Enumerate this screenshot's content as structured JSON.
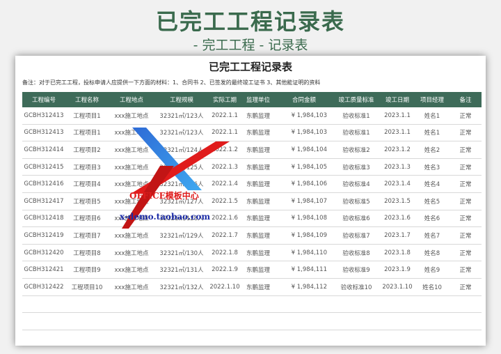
{
  "hero": {
    "title": "已完工工程记录表",
    "subtitle": "- 完工工程  - 记录表"
  },
  "sheet": {
    "title": "已完工工程记录表",
    "note": "备注：对于已完工工程，投标申请人应提供一下方面的材料：1、合同书 2、已签发的最终竣工证书 3、其他能证明的资料"
  },
  "table": {
    "headers": [
      "工程编号",
      "工程名称",
      "工程地点",
      "工程规模",
      "实际工期",
      "监理单位",
      "合同金额",
      "竣工质量标准",
      "竣工日期",
      "项目经理",
      "备注"
    ],
    "rows": [
      [
        "GCBH312413",
        "工程项目1",
        "xxx施工地点",
        "32321㎡/123人",
        "2022.1.1",
        "东鹏监理",
        "¥ 1,984,103",
        "验收标准1",
        "2023.1.1",
        "姓名1",
        "正常"
      ],
      [
        "GCBH312413",
        "工程项目1",
        "xxx施工地点",
        "32321㎡/123人",
        "2022.1.1",
        "东鹏监理",
        "¥ 1,984,103",
        "验收标准1",
        "2023.1.1",
        "姓名1",
        "正常"
      ],
      [
        "GCBH312414",
        "工程项目2",
        "xxx施工地点",
        "32321㎡/124人",
        "2022.1.2",
        "东鹏监理",
        "¥ 1,984,104",
        "验收标准2",
        "2023.1.2",
        "姓名2",
        "正常"
      ],
      [
        "GCBH312415",
        "工程项目3",
        "xxx施工地点",
        "32321㎡/125人",
        "2022.1.3",
        "东鹏监理",
        "¥ 1,984,105",
        "验收标准3",
        "2023.1.3",
        "姓名3",
        "正常"
      ],
      [
        "GCBH312416",
        "工程项目4",
        "xxx施工地点",
        "32321㎡/126人",
        "2022.1.4",
        "东鹏监理",
        "¥ 1,984,106",
        "验收标准4",
        "2023.1.4",
        "姓名4",
        "正常"
      ],
      [
        "GCBH312417",
        "工程项目5",
        "xxx施工地点",
        "32321㎡/127人",
        "2022.1.5",
        "东鹏监理",
        "¥ 1,984,107",
        "验收标准5",
        "2023.1.5",
        "姓名5",
        "正常"
      ],
      [
        "GCBH312418",
        "工程项目6",
        "xxx施工地点",
        "32321㎡/128人",
        "2022.1.6",
        "东鹏监理",
        "¥ 1,984,108",
        "验收标准6",
        "2023.1.6",
        "姓名6",
        "正常"
      ],
      [
        "GCBH312419",
        "工程项目7",
        "xxx施工地点",
        "32321㎡/129人",
        "2022.1.7",
        "东鹏监理",
        "¥ 1,984,109",
        "验收标准7",
        "2023.1.7",
        "姓名7",
        "正常"
      ],
      [
        "GCBH312420",
        "工程项目8",
        "xxx施工地点",
        "32321㎡/130人",
        "2022.1.8",
        "东鹏监理",
        "¥ 1,984,110",
        "验收标准8",
        "2023.1.8",
        "姓名8",
        "正常"
      ],
      [
        "GCBH312421",
        "工程项目9",
        "xxx施工地点",
        "32321㎡/131人",
        "2022.1.9",
        "东鹏监理",
        "¥ 1,984,111",
        "验收标准9",
        "2023.1.9",
        "姓名9",
        "正常"
      ],
      [
        "GCBH312422",
        "工程项目10",
        "xxx施工地点",
        "32321㎡/132人",
        "2022.1.10",
        "东鹏监理",
        "¥ 1,984,112",
        "验收标准10",
        "2023.1.10",
        "姓名10",
        "正常"
      ]
    ],
    "empty_rows": 2
  },
  "watermark": {
    "logo_text": "OFFICE模板中心",
    "url_text": "x-demo.taobao.com"
  },
  "colors": {
    "header_bg": "#3e6b59",
    "title_green": "#3a6a4d"
  }
}
